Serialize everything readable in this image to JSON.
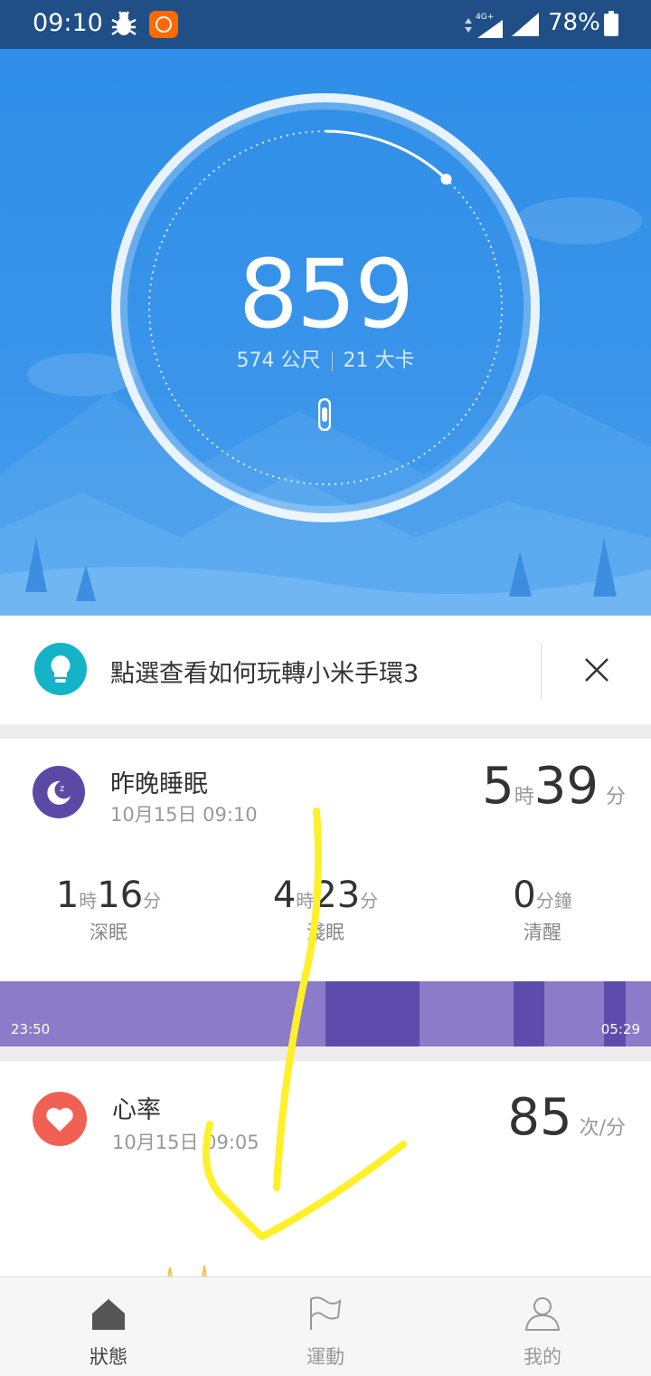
{
  "status_bar": {
    "time": "09:10",
    "network": "4G+",
    "battery_percent": "78%",
    "icons": [
      "bug-icon",
      "mi-app-icon",
      "signal-icon",
      "signal-icon",
      "battery-icon"
    ]
  },
  "hero": {
    "steps": "859",
    "distance": "574 公尺",
    "calories": "21 大卡",
    "goal_progress_fraction": 0.12,
    "colors": {
      "accent": "#2f8ee8"
    }
  },
  "tip_banner": {
    "text": "點選查看如何玩轉小米手環3",
    "icon": "lightbulb-icon",
    "close_icon": "close-icon"
  },
  "sleep": {
    "title": "昨晚睡眠",
    "date": "10月15日 09:10",
    "total_hours": "5",
    "hours_unit": "時",
    "total_minutes": "39",
    "minutes_unit": "分",
    "stages": [
      {
        "num1": "1",
        "unit1": "時",
        "num2": "16",
        "unit2": "分",
        "label": "深眠"
      },
      {
        "num1": "4",
        "unit1": "時",
        "num2": "23",
        "unit2": "分",
        "label": "淺眠"
      },
      {
        "num1": "0",
        "unit1": "分鐘",
        "num2": "",
        "unit2": "",
        "label": "清醒"
      }
    ],
    "start_time": "23:50",
    "end_time": "05:29",
    "colors": {
      "light": "#8b7bc9",
      "deep": "#5e4cad"
    }
  },
  "heart_rate": {
    "title": "心率",
    "date": "10月15日 09:05",
    "value": "85",
    "unit": "次/分"
  },
  "bottom_nav": {
    "items": [
      {
        "label": "狀態",
        "icon": "home-icon",
        "active": true
      },
      {
        "label": "運動",
        "icon": "flag-icon",
        "active": false
      },
      {
        "label": "我的",
        "icon": "person-icon",
        "active": false
      }
    ]
  }
}
